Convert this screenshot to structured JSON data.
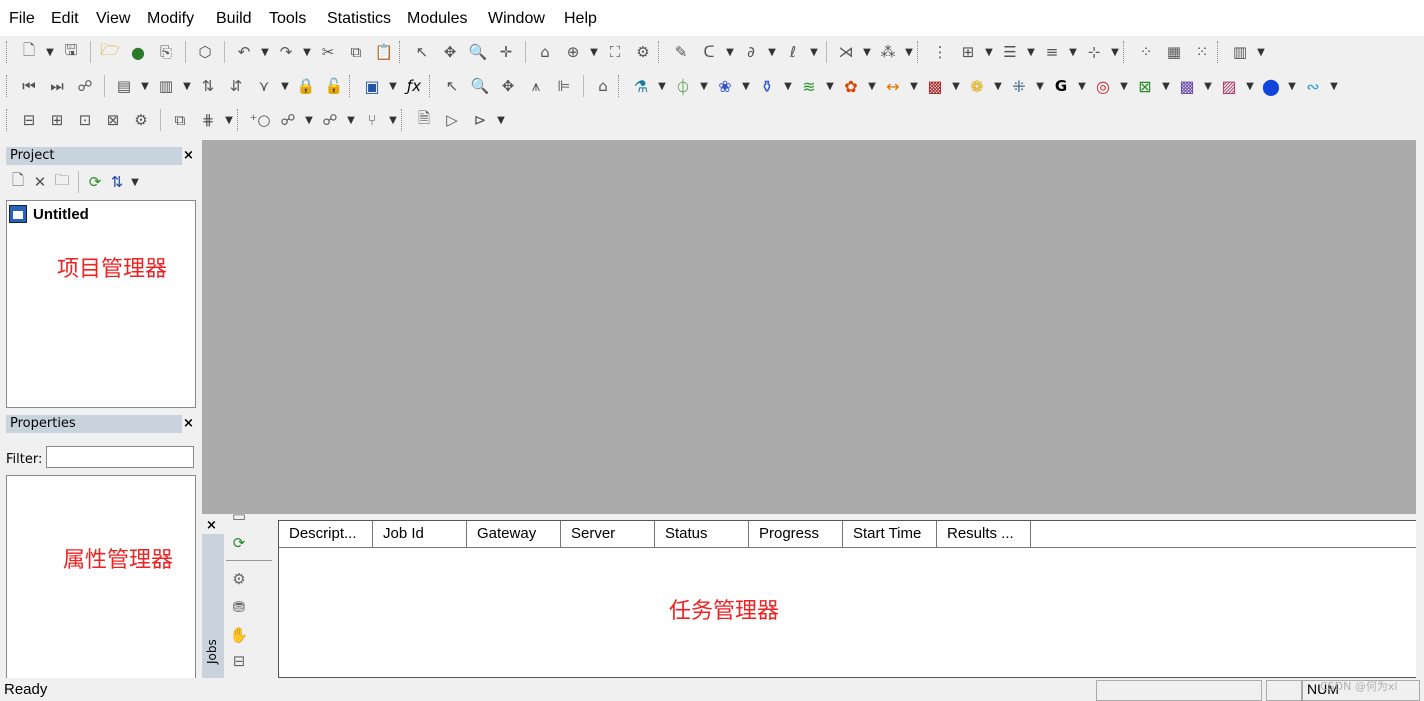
{
  "menu": [
    "File",
    "Edit",
    "View",
    "Modify",
    "Build",
    "Tools",
    "Statistics",
    "Modules",
    "Window",
    "Help"
  ],
  "toolbar1_icons": [
    "new-doc-icon",
    "dropdown",
    "save-icon",
    "open-folder-icon",
    "open-web-icon",
    "export-icon",
    "cube-icon",
    "undo-icon",
    "dropdown",
    "redo-icon",
    "dropdown",
    "cut-icon",
    "copy-icon",
    "paste-icon",
    "select-arrow-icon",
    "pan-icon",
    "zoom-icon",
    "move-icon",
    "home-icon",
    "target-icon",
    "dropdown",
    "fit-icon",
    "settings-icon",
    "pencil-icon",
    "arc-icon",
    "dropdown",
    "curve-icon",
    "dropdown",
    "freehand-icon",
    "dropdown",
    "bond-icon",
    "dropdown",
    "atoms-icon",
    "dropdown",
    "grid-icon",
    "bracket-icon",
    "dropdown",
    "surface-icon",
    "dropdown",
    "lines-icon",
    "dropdown",
    "axis-icon",
    "dropdown",
    "molecule-icon",
    "crystal-icon",
    "cluster-icon",
    "chart-icon",
    "dropdown"
  ],
  "project": {
    "header": "Project",
    "close": "×",
    "tree_root": "Untitled"
  },
  "properties": {
    "header": "Properties",
    "close": "×",
    "filter_label": "Filter:",
    "filter_value": ""
  },
  "annotations": {
    "project_manager": "项目管理器",
    "properties_manager": "属性管理器",
    "job_manager": "任务管理器"
  },
  "jobs": {
    "tab_label": "Jobs",
    "close": "×",
    "columns": [
      "Descript...",
      "Job Id",
      "Gateway",
      "Server",
      "Status",
      "Progress",
      "Start Time",
      "Results ..."
    ]
  },
  "status": {
    "text": "Ready",
    "num": "NUM",
    "watermark": "CSDN @何为xl"
  },
  "colors": {
    "mdi_background": "#ababab",
    "panel_header": "#c8d3de",
    "annotation_red": "#ee2222"
  }
}
